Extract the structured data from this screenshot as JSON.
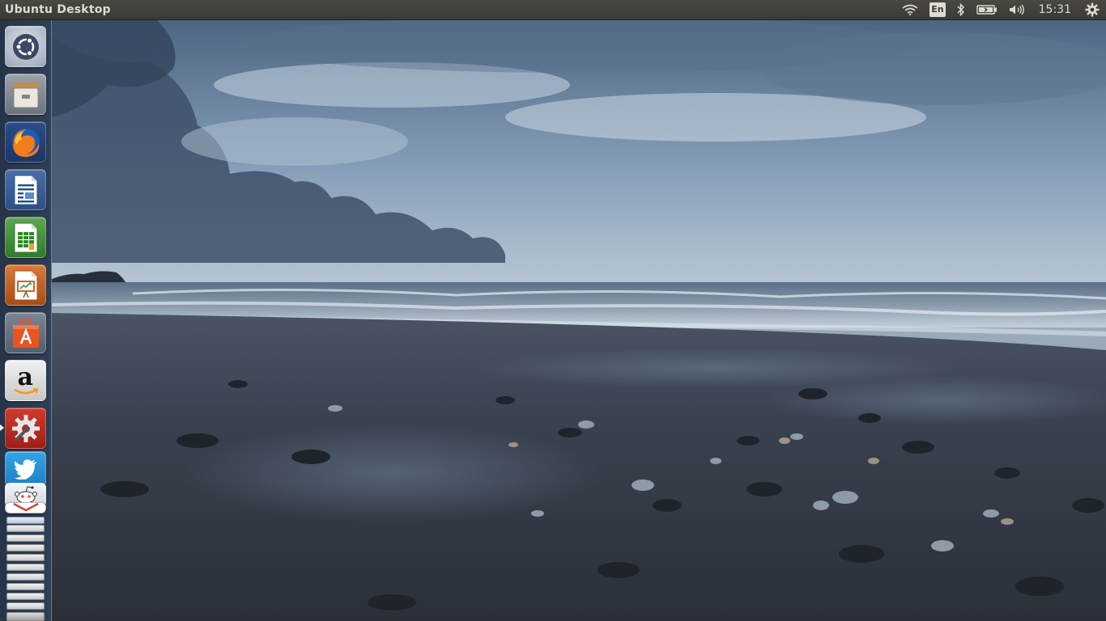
{
  "top_panel": {
    "window_title": "Ubuntu Desktop",
    "indicators": {
      "network_icon": "wifi-icon",
      "keyboard_layout": "En",
      "bluetooth_icon": "bluetooth-icon",
      "battery_icon": "battery-icon",
      "sound_icon": "volume-icon",
      "clock": "15:31",
      "session_icon": "gear-icon"
    }
  },
  "launcher": {
    "items": [
      {
        "name": "Search your computer (Dash)",
        "icon": "ubuntu-logo-icon"
      },
      {
        "name": "Files",
        "icon": "file-cabinet-icon"
      },
      {
        "name": "Firefox Web Browser",
        "icon": "firefox-icon"
      },
      {
        "name": "LibreOffice Writer",
        "icon": "writer-icon"
      },
      {
        "name": "LibreOffice Calc",
        "icon": "calc-icon"
      },
      {
        "name": "LibreOffice Impress",
        "icon": "impress-icon"
      },
      {
        "name": "Ubuntu Software",
        "icon": "software-center-icon"
      },
      {
        "name": "Amazon",
        "icon": "amazon-icon",
        "label": "a"
      },
      {
        "name": "System Settings",
        "icon": "system-settings-icon"
      },
      {
        "name": "Twitter",
        "icon": "twitter-icon"
      },
      {
        "name": "Reddit",
        "icon": "reddit-icon"
      },
      {
        "name": "Gmail",
        "icon": "gmail-icon"
      }
    ],
    "active_item": "System Settings"
  },
  "colors": {
    "panel": "#3c3b37",
    "panel_text": "#dfdbd2",
    "launcher_bg": "#2c3a4e",
    "ubuntu_orange": "#e95420"
  },
  "wallpaper": {
    "description": "stormy beach with pebbles and grey-blue sky"
  }
}
